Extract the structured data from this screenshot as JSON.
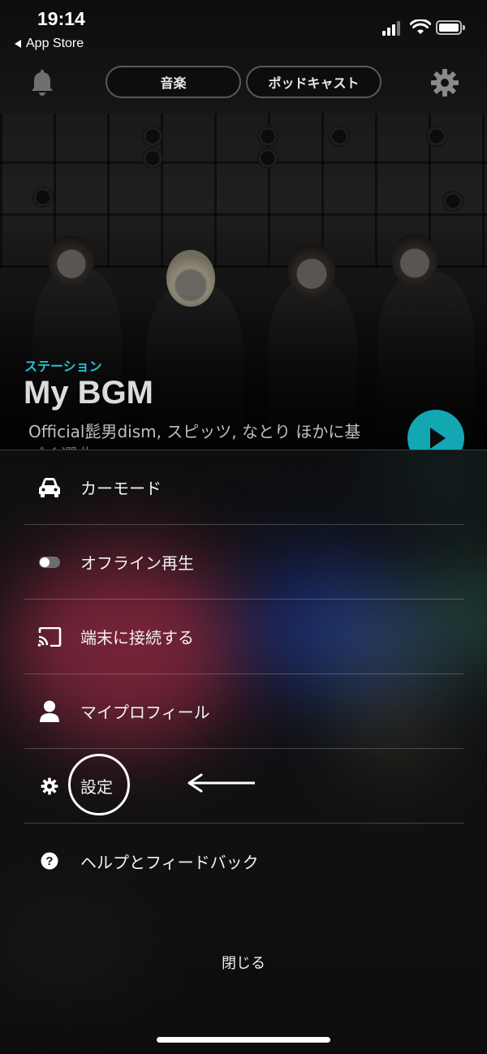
{
  "status_bar": {
    "time": "19:14",
    "back_label": "App Store"
  },
  "header": {
    "tabs": [
      {
        "label": "音楽"
      },
      {
        "label": "ポッドキャスト"
      }
    ],
    "left_icon": "bell-icon",
    "right_icon": "gear-icon"
  },
  "hero": {
    "kicker": "ステーション",
    "title": "My BGM",
    "subtitle_line1": "Official髭男dism, スピッツ, なとり ほかに基",
    "subtitle_line2": "づく選曲",
    "accent_color": "#25c3d3",
    "play_icon": "play-icon"
  },
  "menu": {
    "items": [
      {
        "label": "カーモード",
        "icon": "car-icon"
      },
      {
        "label": "オフライン再生",
        "icon": "toggle-icon"
      },
      {
        "label": "端末に接続する",
        "icon": "cast-icon"
      },
      {
        "label": "マイプロフィール",
        "icon": "person-icon"
      },
      {
        "label": "設定",
        "icon": "gear-icon"
      },
      {
        "label": "ヘルプとフィードバック",
        "icon": "help-icon"
      }
    ],
    "close_label": "閉じる"
  }
}
